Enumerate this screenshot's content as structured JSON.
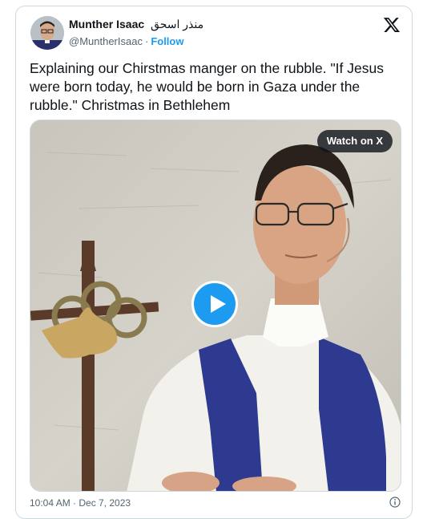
{
  "author": {
    "name": "Munther Isaac",
    "name_arabic": "منذر اسحق",
    "handle": "@MuntherIsaac",
    "follow_label": "Follow"
  },
  "tweet": {
    "text": "Explaining our Chirstmas manger on the rubble. \"If Jesus were born today, he would be born in Gaza under the rubble.\" Christmas in Bethlehem"
  },
  "media": {
    "watch_label": "Watch on X",
    "icon": "play-icon"
  },
  "footer": {
    "timestamp": "10:04 AM · Dec 7, 2023"
  },
  "colors": {
    "accent": "#1d9bf0",
    "text": "#0f1419",
    "secondary": "#536471",
    "stole": "#2e3a8f"
  }
}
